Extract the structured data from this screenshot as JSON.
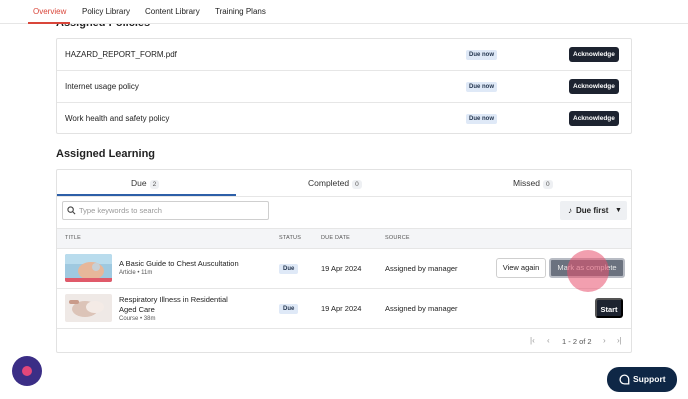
{
  "nav": {
    "tabs": [
      {
        "label": "Overview",
        "active": true
      },
      {
        "label": "Policy Library",
        "active": false
      },
      {
        "label": "Content Library",
        "active": false
      },
      {
        "label": "Training Plans",
        "active": false
      }
    ]
  },
  "policies": {
    "title": "Assigned Policies",
    "rows": [
      {
        "name": "HAZARD_REPORT_FORM.pdf",
        "status": "Due now",
        "action": "Acknowledge"
      },
      {
        "name": "Internet usage policy",
        "status": "Due now",
        "action": "Acknowledge"
      },
      {
        "name": "Work health and safety policy",
        "status": "Due now",
        "action": "Acknowledge"
      }
    ]
  },
  "learning": {
    "title": "Assigned Learning",
    "tabs": [
      {
        "label": "Due",
        "count": "2",
        "active": true
      },
      {
        "label": "Completed",
        "count": "0",
        "active": false
      },
      {
        "label": "Missed",
        "count": "0",
        "active": false
      }
    ],
    "search": {
      "placeholder": "Type keywords to search",
      "value": ""
    },
    "sort": {
      "icon": "music-note-sort-icon",
      "label": "Due first",
      "caret": "▼"
    },
    "columns": [
      "TITLE",
      "STATUS",
      "DUE DATE",
      "SOURCE"
    ],
    "rows": [
      {
        "title": "A Basic Guide to Chest Auscultation",
        "meta": "Article • 11m",
        "status": "Due",
        "due_date": "19 Apr 2024",
        "source": "Assigned by manager",
        "actions": {
          "view": "View again",
          "complete": "Mark as complete"
        }
      },
      {
        "title_line1": "Respiratory Illness in Residential",
        "title_line2": "Aged Care",
        "meta": "Course • 38m",
        "status": "Due",
        "due_date": "19 Apr 2024",
        "source": "Assigned by manager",
        "actions": {
          "start": "Start"
        }
      }
    ],
    "pagination": {
      "range": "1 - 2 of 2",
      "first": "|‹",
      "prev": "‹",
      "next": "›",
      "last": "›|"
    }
  },
  "support": {
    "label": "Support"
  },
  "colors": {
    "accent": "#d9463a",
    "tab_underline": "#2d5fa8",
    "dark_button": "#1d2330",
    "support_bg": "#0f2746",
    "fab_bg": "#3b2e86",
    "click_marker": "#e8506e"
  }
}
